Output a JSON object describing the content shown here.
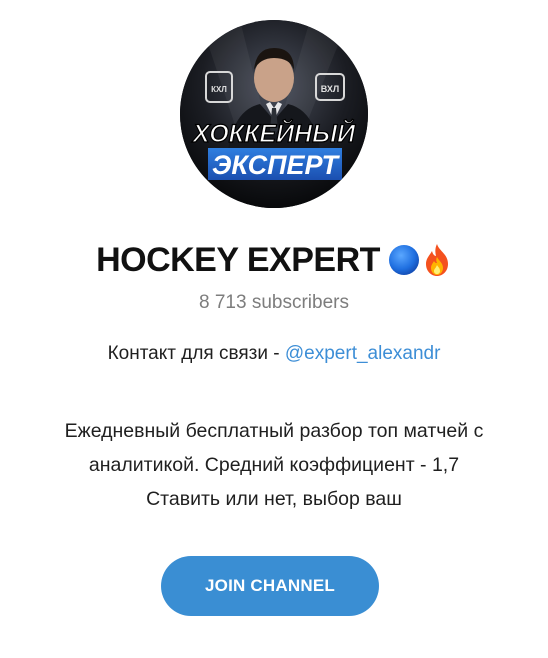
{
  "channel": {
    "avatar": {
      "name": "channel-avatar",
      "text_line_1": "ХОККЕЙНЫЙ",
      "text_line_2": "ЭКСПЕРТ",
      "badge_left": "КХЛ",
      "badge_right": "ВХЛ"
    },
    "title": "HOCKEY EXPERT",
    "title_emojis": [
      "blue-circle-icon",
      "fire-icon"
    ],
    "subscribers": "8 713 subscribers",
    "contact": {
      "label": "Контакт для связи - ",
      "link": "@expert_alexandr"
    },
    "description_lines": [
      "Ежедневный бесплатный разбор топ матчей с",
      "аналитикой. Средний коэффициент - 1,7",
      "Ставить или нет, выбор ваш"
    ],
    "join_button": "JOIN CHANNEL"
  },
  "colors": {
    "accent": "#3a8ed3",
    "link": "#3d8ed6",
    "muted": "#7d7d7d",
    "text": "#1f1f1f"
  }
}
